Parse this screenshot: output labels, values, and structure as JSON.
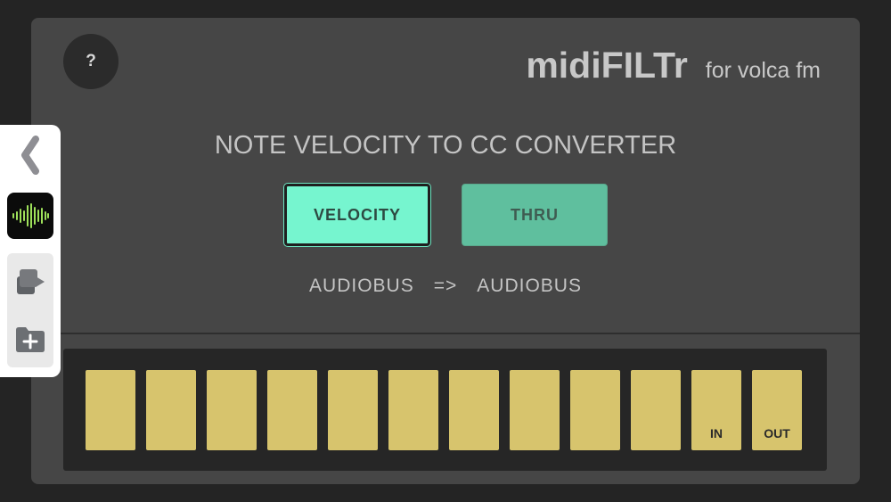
{
  "app": {
    "help_label": "?",
    "brand_name": "midiFILTr",
    "brand_sub": "for volca fm"
  },
  "main": {
    "heading": "NOTE VELOCITY TO CC CONVERTER",
    "modes": [
      {
        "label": "VELOCITY",
        "selected": true
      },
      {
        "label": "THRU",
        "selected": false
      }
    ],
    "route": {
      "source": "AUDIOBUS",
      "arrow": "=>",
      "destination": "AUDIOBUS"
    }
  },
  "pads": [
    {
      "label": ""
    },
    {
      "label": ""
    },
    {
      "label": ""
    },
    {
      "label": ""
    },
    {
      "label": ""
    },
    {
      "label": ""
    },
    {
      "label": ""
    },
    {
      "label": ""
    },
    {
      "label": ""
    },
    {
      "label": ""
    },
    {
      "label": "IN"
    },
    {
      "label": "OUT"
    }
  ],
  "audiobus_panel": {
    "icons": [
      "chevron-left-icon",
      "audiobus-waveform-icon",
      "connection-export-icon",
      "add-folder-icon"
    ]
  },
  "colors": {
    "background": "#242424",
    "device": "#464646",
    "velocity_active": "#76f5cf",
    "thru": "#5fbf9e",
    "pad": "#d7c46d",
    "waveform_green": "#9ee05a"
  }
}
